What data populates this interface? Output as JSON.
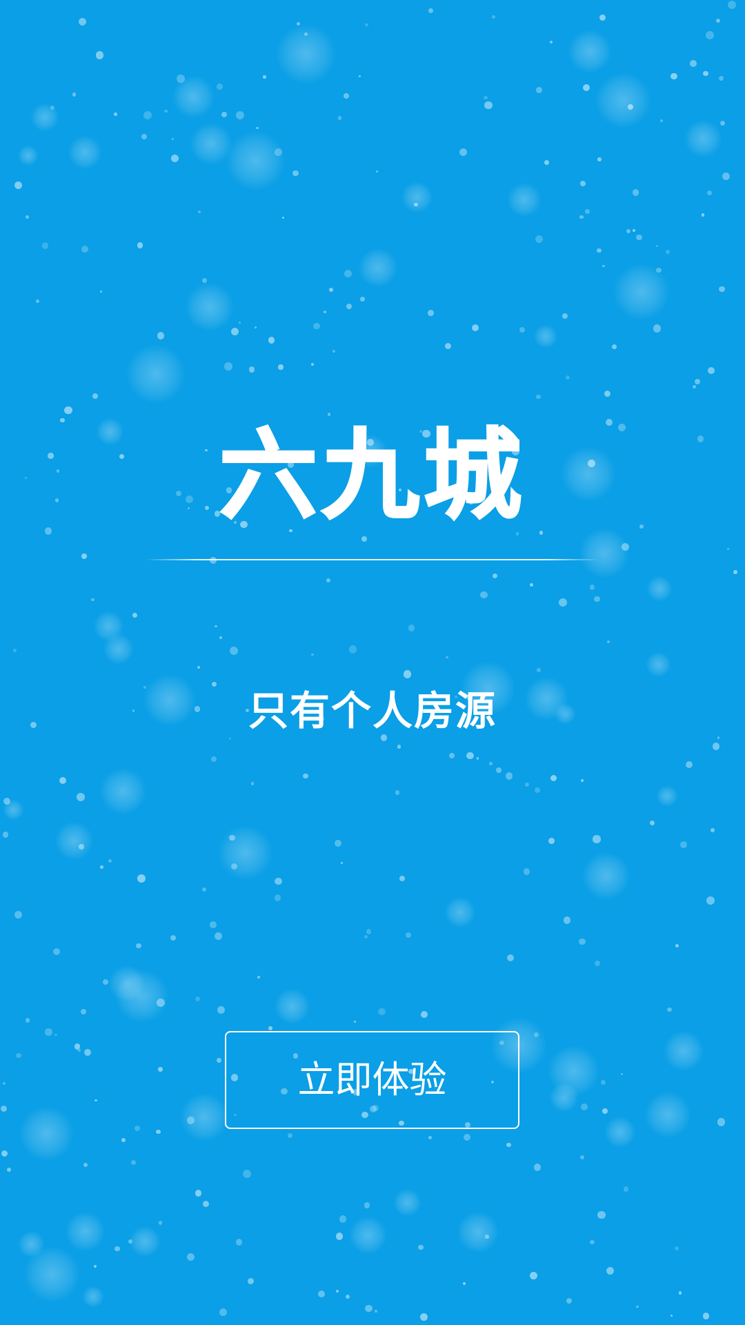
{
  "splash": {
    "title": "六九城",
    "slogan": "只有个人房源",
    "cta_label": "立即体验"
  },
  "colors": {
    "background": "#0a9fe6",
    "foreground": "#ffffff"
  }
}
